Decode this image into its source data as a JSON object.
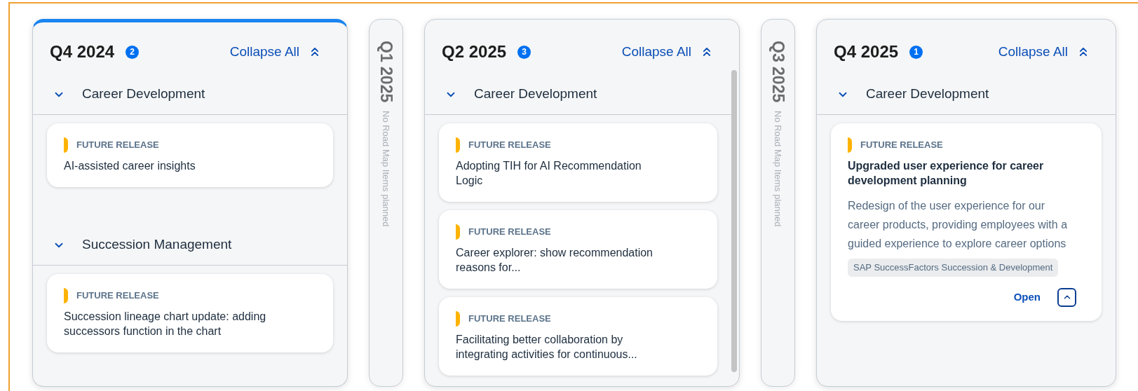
{
  "columns": [
    {
      "kind": "expanded",
      "current": true,
      "title": "Q4 2024",
      "count": "2",
      "collapse_label": "Collapse All",
      "scrollbar": false,
      "groups": [
        {
          "title": "Career Development",
          "expanded": true,
          "items": [
            {
              "kind": "brief",
              "status": "FUTURE RELEASE",
              "title": "AI-assisted career insights"
            }
          ]
        },
        {
          "title": "Succession Management",
          "expanded": true,
          "items": [
            {
              "kind": "brief",
              "status": "FUTURE RELEASE",
              "title": "Succession lineage chart update: adding successors function in the chart"
            }
          ]
        }
      ]
    },
    {
      "kind": "collapsed",
      "title": "Q1 2025",
      "note": "No Road Map Items planned"
    },
    {
      "kind": "expanded",
      "current": false,
      "title": "Q2 2025",
      "count": "3",
      "collapse_label": "Collapse All",
      "scrollbar": true,
      "groups": [
        {
          "title": "Career Development",
          "expanded": true,
          "items": [
            {
              "kind": "brief",
              "status": "FUTURE RELEASE",
              "title": "Adopting TIH for AI Recommendation Logic"
            },
            {
              "kind": "brief",
              "status": "FUTURE RELEASE",
              "title": "Career explorer: show recommendation reasons for..."
            },
            {
              "kind": "brief",
              "status": "FUTURE RELEASE",
              "title": "Facilitating better collaboration by integrating activities for continuous..."
            }
          ]
        }
      ]
    },
    {
      "kind": "collapsed",
      "title": "Q3 2025",
      "note": "No Road Map Items planned"
    },
    {
      "kind": "expanded",
      "current": false,
      "title": "Q4 2025",
      "count": "1",
      "collapse_label": "Collapse All",
      "scrollbar": false,
      "groups": [
        {
          "title": "Career Development",
          "expanded": true,
          "items": [
            {
              "kind": "detailed",
              "status": "FUTURE RELEASE",
              "title": "Upgraded user experience for career development planning",
              "description": "Redesign of the user experience for our career products, providing employees with a guided experience to explore career options",
              "tag": "SAP SuccessFactors Succession & Development",
              "action": "Open",
              "expanded": true
            }
          ]
        }
      ]
    }
  ]
}
